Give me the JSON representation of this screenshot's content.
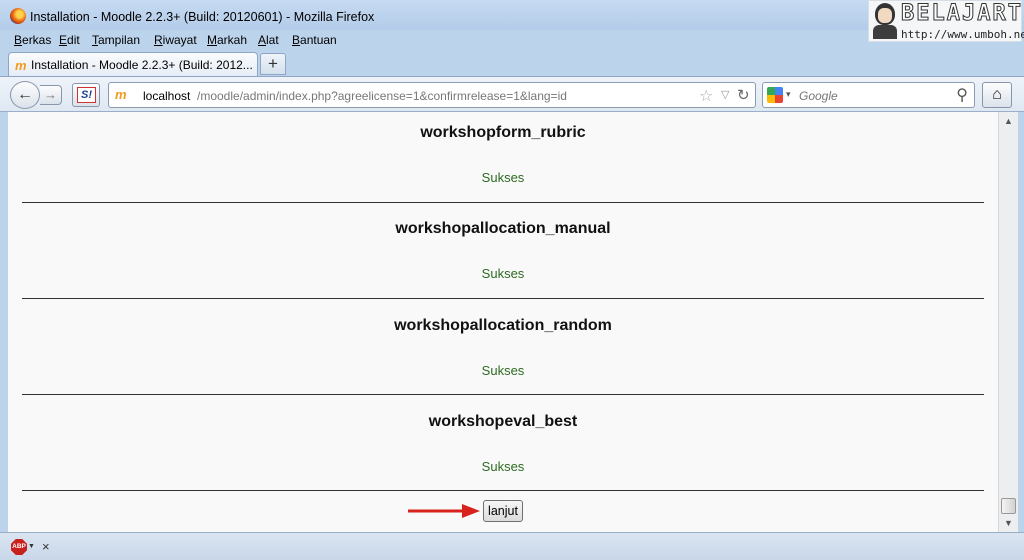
{
  "window": {
    "title": "Installation - Moodle 2.2.3+ (Build: 20120601) - Mozilla Firefox",
    "watermark_logo": "BELAJARTIK",
    "watermark_url": "http://www.umboh.net"
  },
  "menu": [
    "Berkas",
    "Edit",
    "Tampilan",
    "Riwayat",
    "Markah",
    "Alat",
    "Bantuan"
  ],
  "tab": {
    "icon_text": "m",
    "title": "Installation - Moodle 2.2.3+ (Build: 2012...",
    "new_tab_label": "+"
  },
  "toolbar": {
    "back_label": "←",
    "forward_label": "→",
    "si_label": "S!",
    "url_host": "localhost",
    "url_path": "/moodle/admin/index.php?agreelicense=1&confirmrelease=1&lang=id",
    "search_placeholder": "Google",
    "star_icon": "☆",
    "reload_icon": "↻",
    "search_icon": "⚲",
    "home_icon": "⌂"
  },
  "sections": [
    {
      "heading": "workshopform_rubric",
      "status": "Sukses"
    },
    {
      "heading": "workshopallocation_manual",
      "status": "Sukses"
    },
    {
      "heading": "workshopallocation_random",
      "status": "Sukses"
    },
    {
      "heading": "workshopeval_best",
      "status": "Sukses"
    }
  ],
  "continue_button": "lanjut",
  "addon_bar": {
    "abp_label": "ABP",
    "close_label": "×"
  },
  "colors": {
    "success_text": "#2d6b22",
    "annotation_arrow": "#d8231c",
    "window_frame": "#bcd3ec"
  }
}
